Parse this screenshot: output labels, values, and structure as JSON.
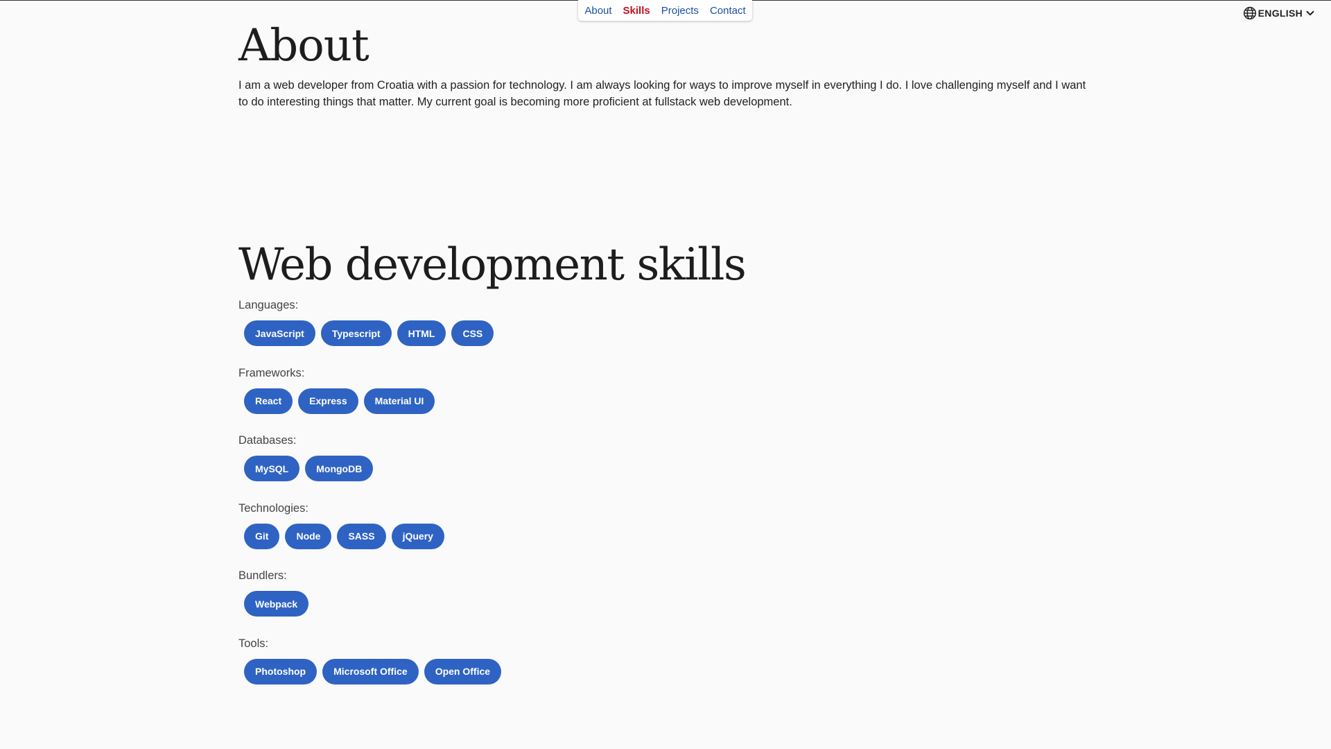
{
  "nav": {
    "items": [
      {
        "label": "About",
        "active": false
      },
      {
        "label": "Skills",
        "active": true
      },
      {
        "label": "Projects",
        "active": false
      },
      {
        "label": "Contact",
        "active": false
      }
    ]
  },
  "language": {
    "label": "ENGLISH",
    "icon": "globe-icon"
  },
  "about": {
    "title": "About",
    "text": "I am a web developer from Croatia with a passion for technology. I am always looking for ways to improve myself in everything I do. I love challenging myself and I want to do interesting things that matter. My current goal is becoming more proficient at fullstack web development."
  },
  "skills": {
    "title": "Web development skills",
    "groups": [
      {
        "label": "Languages:",
        "items": [
          "JavaScript",
          "Typescript",
          "HTML",
          "CSS"
        ]
      },
      {
        "label": "Frameworks:",
        "items": [
          "React",
          "Express",
          "Material UI"
        ]
      },
      {
        "label": "Databases:",
        "items": [
          "MySQL",
          "MongoDB"
        ]
      },
      {
        "label": "Technologies:",
        "items": [
          "Git",
          "Node",
          "SASS",
          "jQuery"
        ]
      },
      {
        "label": "Bundlers:",
        "items": [
          "Webpack"
        ]
      },
      {
        "label": "Tools:",
        "items": [
          "Photoshop",
          "Microsoft Office",
          "Open Office"
        ]
      }
    ]
  },
  "colors": {
    "chip": "#2f63c3",
    "nav_link": "#1a4fa0",
    "nav_active": "#c0111f",
    "background": "#fafafa"
  }
}
